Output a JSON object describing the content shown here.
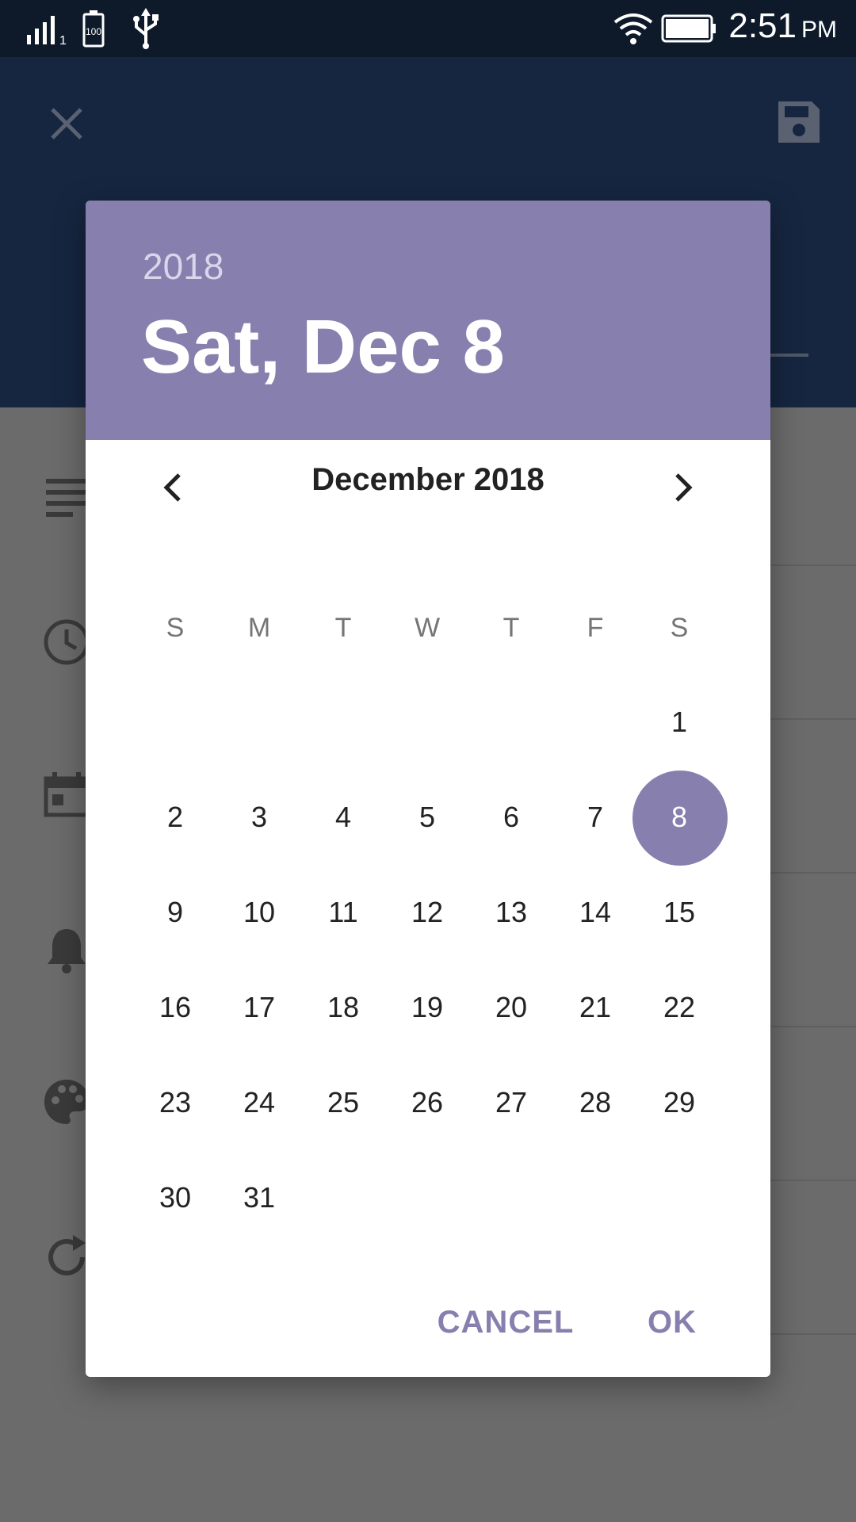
{
  "status_bar": {
    "time": "2:51",
    "ampm": "PM",
    "battery_label": "100",
    "sim_label": "1"
  },
  "toolbar": {
    "close_icon": "close-icon",
    "save_icon": "save-icon"
  },
  "background_list": {
    "icons": [
      "notes-icon",
      "clock-icon",
      "calendar-icon",
      "bell-icon",
      "palette-icon",
      "repeat-icon"
    ]
  },
  "dialog": {
    "year": "2018",
    "date": "Sat, Dec 8",
    "month_label": "December 2018",
    "weekdays": [
      "S",
      "M",
      "T",
      "W",
      "T",
      "F",
      "S"
    ],
    "days": [
      "1",
      "2",
      "3",
      "4",
      "5",
      "6",
      "7",
      "8",
      "9",
      "10",
      "11",
      "12",
      "13",
      "14",
      "15",
      "16",
      "17",
      "18",
      "19",
      "20",
      "21",
      "22",
      "23",
      "24",
      "25",
      "26",
      "27",
      "28",
      "29",
      "30",
      "31"
    ],
    "first_weekday_index": 6,
    "selected_day": "8",
    "cancel_label": "CANCEL",
    "ok_label": "OK",
    "accent_color": "#877fae"
  }
}
